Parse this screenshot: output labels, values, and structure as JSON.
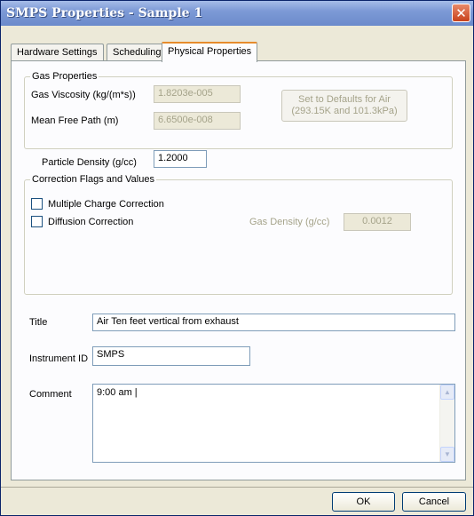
{
  "window": {
    "title": "SMPS Properties - Sample 1",
    "close_glyph": "✕"
  },
  "tabs": [
    {
      "label": "Hardware Settings",
      "active": false
    },
    {
      "label": "Scheduling",
      "active": false
    },
    {
      "label": "Physical Properties",
      "active": true
    }
  ],
  "gas_properties": {
    "legend": "Gas Properties",
    "viscosity_label": "Gas Viscosity (kg/(m*s))",
    "viscosity_value": "1.8203e-005",
    "mean_free_path_label": "Mean Free Path (m)",
    "mean_free_path_value": "6.6500e-008",
    "defaults_button_line1": "Set to Defaults for Air",
    "defaults_button_line2": "(293.15K and 101.3kPa)"
  },
  "particle_density": {
    "label": "Particle Density (g/cc)",
    "value": "1.2000"
  },
  "correction": {
    "legend": "Correction Flags and Values",
    "multiple_charge_label": "Multiple Charge Correction",
    "multiple_charge_checked": false,
    "diffusion_label": "Diffusion Correction",
    "diffusion_checked": false,
    "gas_density_label": "Gas Density (g/cc)",
    "gas_density_value": "0.0012"
  },
  "title_field": {
    "label": "Title",
    "value": "Air Ten feet vertical from exhaust"
  },
  "instrument_field": {
    "label": "Instrument ID",
    "value": "SMPS"
  },
  "comment_field": {
    "label": "Comment",
    "value": "9:00 am |"
  },
  "footer": {
    "ok_label": "OK",
    "cancel_label": "Cancel"
  },
  "colors": {
    "titlebar": "#7d9ad6",
    "dialog_bg": "#ece9d8",
    "active_tab_accent": "#e68b2c"
  }
}
